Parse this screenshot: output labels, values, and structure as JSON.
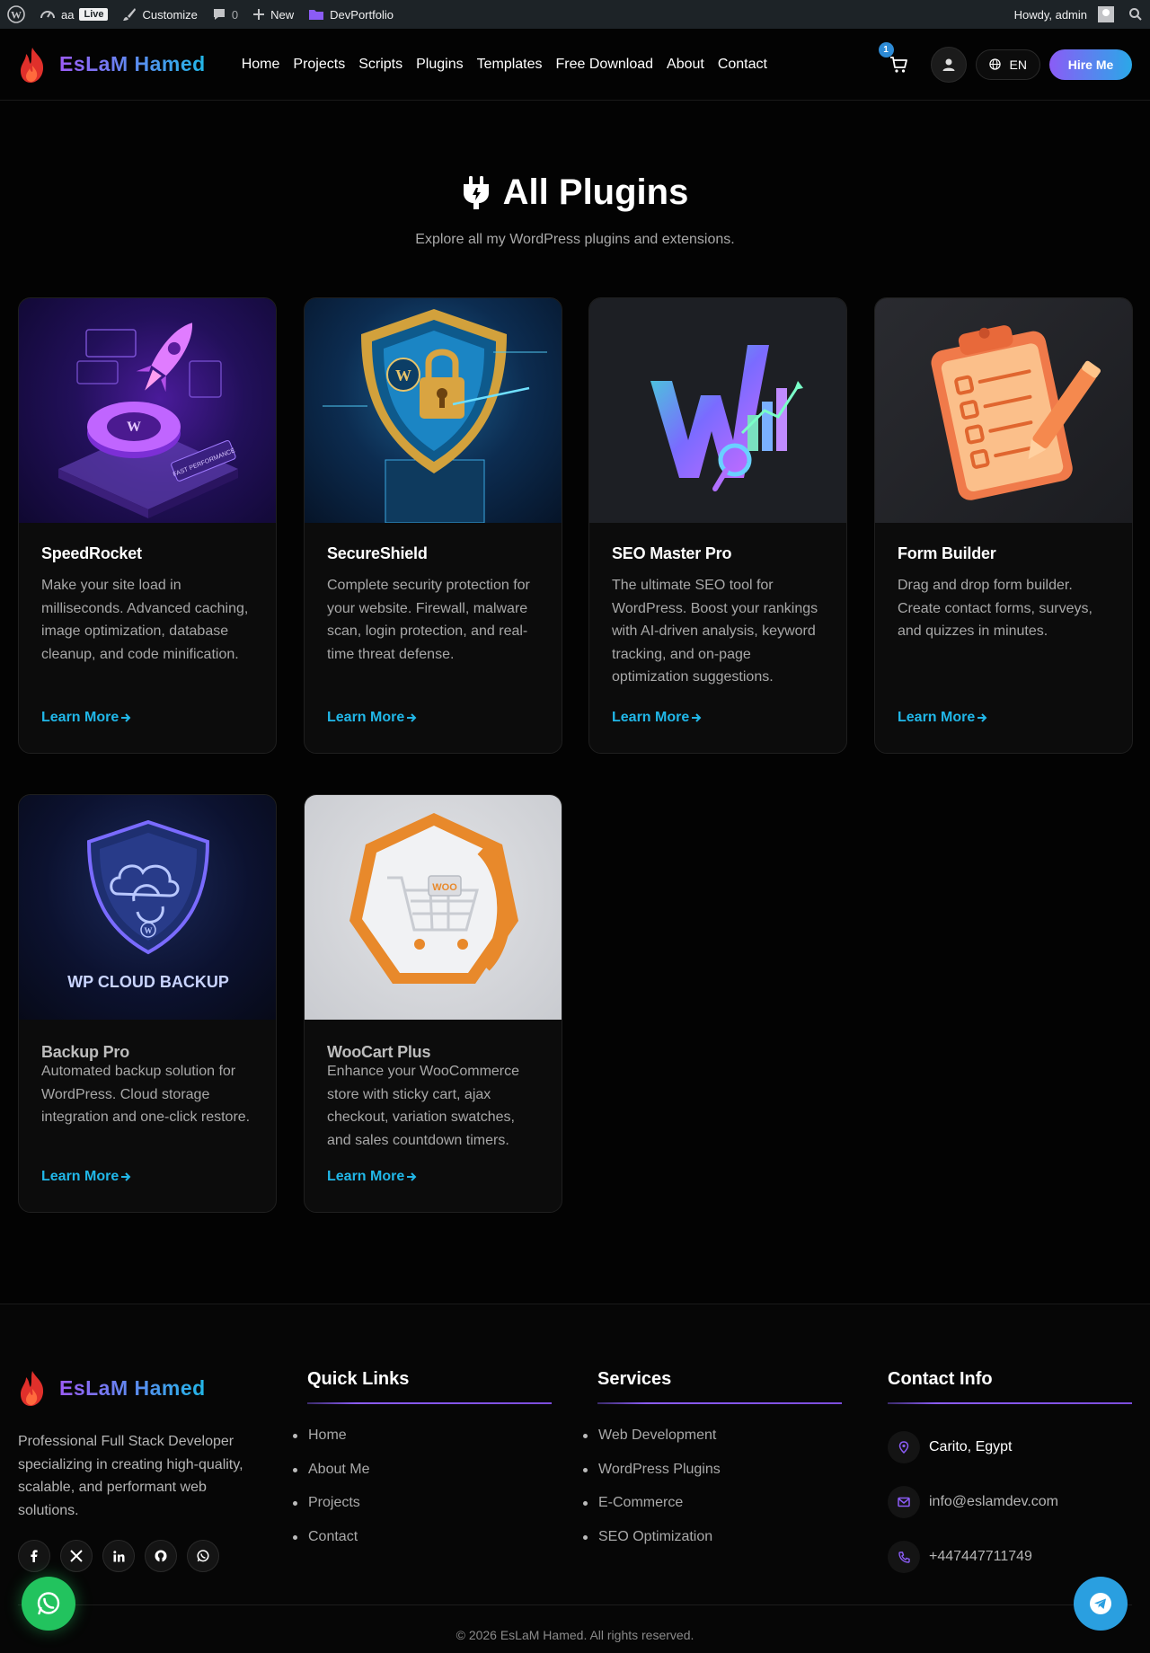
{
  "adminbar": {
    "site_name": "aa",
    "live_badge": "Live",
    "customize": "Customize",
    "comments_count": "0",
    "new": "New",
    "portfolio": "DevPortfolio",
    "howdy": "Howdy, admin"
  },
  "header": {
    "logo_text": "EsLaM Hamed",
    "nav": [
      "Home",
      "Projects",
      "Scripts",
      "Plugins",
      "Templates",
      "Free Download",
      "About",
      "Contact"
    ],
    "cart_count": "1",
    "lang": "EN",
    "hire": "Hire Me"
  },
  "hero": {
    "title": "All Plugins",
    "subtitle": "Explore all my WordPress plugins and extensions."
  },
  "cards": [
    {
      "title": "SpeedRocket",
      "desc": "Make your site load in milliseconds. Advanced caching, image optimization, database cleanup, and code minification.",
      "link": "Learn More",
      "image_text": "FAST PERFORMANCE"
    },
    {
      "title": "SecureShield",
      "desc": "Complete security protection for your website. Firewall, malware scan, login protection, and real-time threat defense.",
      "link": "Learn More"
    },
    {
      "title": "SEO Master Pro",
      "desc": "The ultimate SEO tool for WordPress. Boost your rankings with AI-driven analysis, keyword tracking, and on-page optimization suggestions.",
      "link": "Learn More"
    },
    {
      "title": "Form Builder",
      "desc": "Drag and drop form builder. Create contact forms, surveys, and quizzes in minutes.",
      "link": "Learn More"
    },
    {
      "title": "Backup Pro",
      "desc": "Automated backup solution for WordPress. Cloud storage integration and one-click restore.",
      "link": "Learn More",
      "image_text": "WP CLOUD BACKUP"
    },
    {
      "title": "WooCart Plus",
      "desc": "Enhance your WooCommerce store with sticky cart, ajax checkout, variation swatches, and sales countdown timers.",
      "link": "Learn More",
      "image_text": "WOO"
    }
  ],
  "footer": {
    "logo_text": "EsLaM Hamed",
    "about": "Professional Full Stack Developer specializing in creating high-quality, scalable, and performant web solutions.",
    "quick_links_title": "Quick Links",
    "quick_links": [
      "Home",
      "About Me",
      "Projects",
      "Contact"
    ],
    "services_title": "Services",
    "services": [
      "Web Development",
      "WordPress Plugins",
      "E-Commerce",
      "SEO Optimization"
    ],
    "contact_title": "Contact Info",
    "location": "Carito, Egypt",
    "email": "info@eslamdev.com",
    "phone": "+447447711749",
    "copyright": "© 2026 EsLaM Hamed. All rights reserved."
  },
  "colors": {
    "accent_cyan": "#21b7e8",
    "accent_purple": "#8b5cf6",
    "whatsapp": "#22c35e",
    "telegram": "#2a9fe0"
  }
}
